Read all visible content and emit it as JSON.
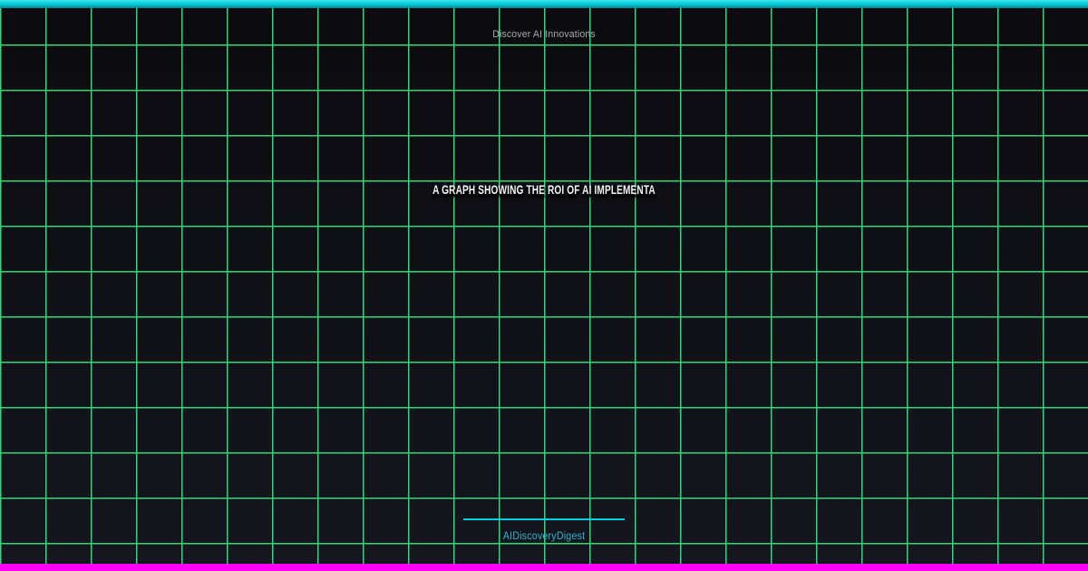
{
  "banner": {
    "tagline": "Discover AI Innovations",
    "title": "A GRAPH SHOWING THE ROI OF AI IMPLEMENTA",
    "brand": "AIDiscoveryDigest"
  },
  "colors": {
    "top_bar": "#00c9d8",
    "bottom_bar": "#fe00f6",
    "grid_line": "#2fe57d",
    "background_top": "#0a0a0f",
    "background_bottom": "#16161f",
    "tagline_text": "#a9abb0",
    "title_text": "#f5f5f5",
    "accent_line": "#00d2e4",
    "brand_text": "#2db6cc"
  }
}
